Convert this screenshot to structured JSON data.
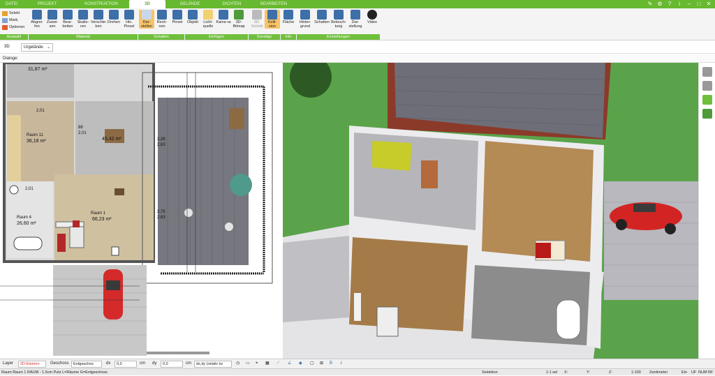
{
  "tabs": [
    {
      "label": "DATEI",
      "active": false
    },
    {
      "label": "PROJEKT",
      "active": false
    },
    {
      "label": "KONSTRUKTION",
      "active": false
    },
    {
      "label": "3D",
      "active": true
    },
    {
      "label": "GELÄNDE",
      "active": false
    },
    {
      "label": "DICHTEN",
      "active": false
    },
    {
      "label": "BEARBEITEN",
      "active": false
    }
  ],
  "ribbon": {
    "select": {
      "selekt": "Selekt",
      "mark": "Mark.",
      "optionen": "Optionen"
    },
    "buttons": [
      "Abgrei-fen",
      "Zuwei-sen",
      "Bear-beiten",
      "Skalie-ren",
      "Verschie-ben",
      "Drehen",
      "Hin. Pinsel",
      "Dar-stellen",
      "Rech-nen",
      "Pinsel",
      "Objekt",
      "Licht-quelle",
      "Kame-ra",
      "3D-Bitmap",
      "3D-Schnitt",
      "Kolli-sion",
      "Fläche",
      "Hinter-grund",
      "Schatten",
      "Beleuch-tung",
      "Dar-stellung",
      "Video"
    ],
    "groups": [
      "Auswahl",
      "Material",
      "Schatten",
      "Einfügen",
      "Sonstige",
      "Info",
      "Einstellungen"
    ]
  },
  "viewbar": {
    "mode": "3D",
    "terrain": "Urgelände"
  },
  "dialog_label": "Dialoge:",
  "plan": {
    "rooms": [
      {
        "area": "31,87 m²"
      },
      {
        "name": "Raum 11",
        "area": "36,18 m²"
      },
      {
        "area": "45,42 m²"
      },
      {
        "name": "Raum 1",
        "area": "66,23 m²"
      },
      {
        "name": "Raum 4",
        "area": "26,60 m²"
      }
    ],
    "dims": [
      "2,01",
      "2,01",
      "2,26",
      "2,63",
      "2,76",
      "2,63",
      "88",
      "2,01"
    ]
  },
  "bottombar": {
    "layer_label": "Layer",
    "layer_value": "2D-Elemen",
    "geschoss_label": "Geschoss",
    "geschoss_value": "Erdgeschos",
    "dx_label": "dx",
    "dx_value": "0,0",
    "dy_label": "dy",
    "dy_value": "0,0",
    "unit": "cm",
    "dxdy_value": "dx,dy (relativ kz"
  },
  "statusbar": {
    "info": "Raum Raum 1 RAUM - 1.5cm Putz L=Räume G=Erdgeschoss",
    "mode": "Selektion",
    "scale_sel": "1:1 sel",
    "x": "X:",
    "y": "Y:",
    "z": "Z:",
    "scale": "1:100",
    "unit": "Zentimeter",
    "ein": "Ein",
    "uf": "UF",
    "num": "NUM",
    "rf": "RF"
  },
  "colors": {
    "accent": "#67b92f",
    "grass": "#5aa34a",
    "deck": "#6e6e74",
    "car": "#d62828",
    "wall": "#e7e7ea",
    "wood": "#b48a55"
  }
}
